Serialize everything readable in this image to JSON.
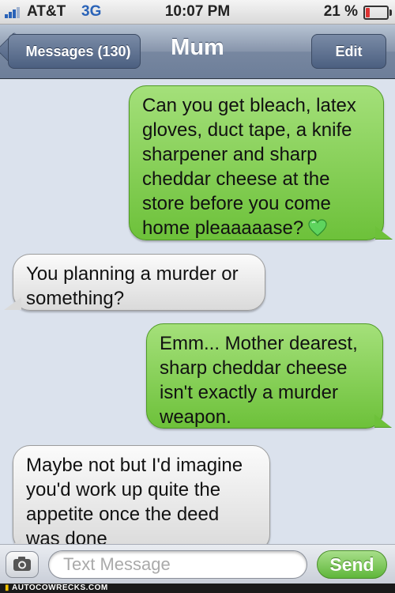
{
  "status_bar": {
    "carrier": "AT&T",
    "network": "3G",
    "time": "10:07 PM",
    "battery": "21 %",
    "battery_level": 0.21
  },
  "nav": {
    "back_label": "Messages (130)",
    "title": "Mum",
    "edit_label": "Edit"
  },
  "messages": [
    {
      "direction": "sent",
      "text": "Can you get bleach, latex\ngloves, duct tape, a knife\nsharpener and sharp\ncheddar cheese at the\nstore before you come\nhome pleaaaaase?",
      "emoji": "green-heart"
    },
    {
      "direction": "received",
      "text": "You planning a murder or\nsomething?"
    },
    {
      "direction": "sent",
      "text": "Emm... Mother dearest,\nsharp cheddar cheese\nisn't exactly a murder\nweapon."
    },
    {
      "direction": "received",
      "text": "Maybe not but I'd imagine\nyou'd work up quite the\nappetite once the deed\nwas done"
    }
  ],
  "composer": {
    "placeholder": "Text Message",
    "send_label": "Send"
  },
  "watermark": "AUTOCOWRECKS.COM",
  "colors": {
    "sent_bubble": "#7dcb4b",
    "received_bubble": "#e9e9e9",
    "chat_background": "#dbe2ed",
    "accent_blue": "#2a63b8"
  }
}
